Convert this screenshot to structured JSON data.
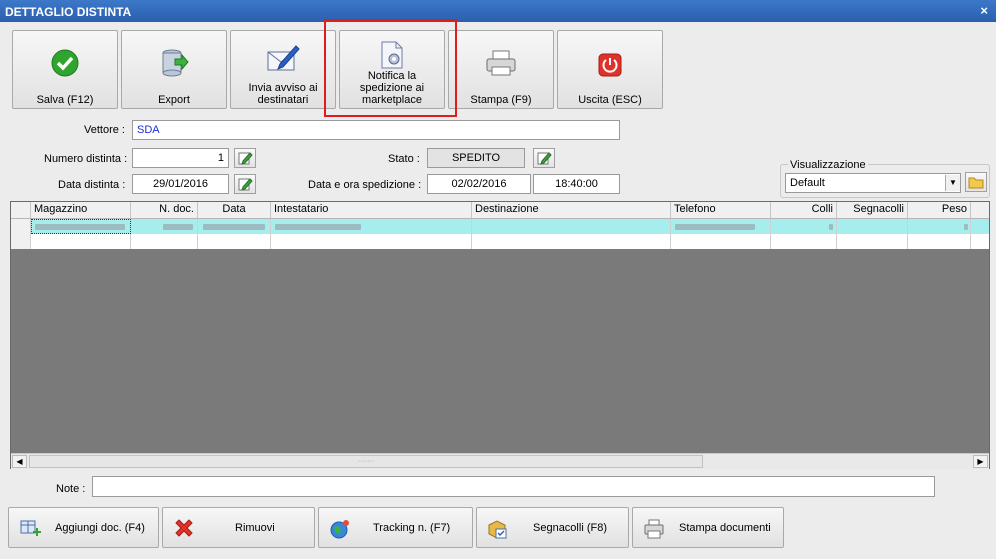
{
  "window": {
    "title": "DETTAGLIO DISTINTA",
    "close": "×"
  },
  "toolbar": {
    "save": "Salva (F12)",
    "export": "Export",
    "notify_recipients": "Invia avviso ai destinatari",
    "notify_marketplace": "Notifica la spedizione ai marketplace",
    "print": "Stampa (F9)",
    "exit": "Uscita (ESC)"
  },
  "form": {
    "carrier_label": "Vettore :",
    "carrier_value": "SDA",
    "number_label": "Numero distinta :",
    "number_value": "1",
    "date_label": "Data distinta :",
    "date_value": "29/01/2016",
    "status_label": "Stato :",
    "status_value": "SPEDITO",
    "ship_label": "Data e ora spedizione :",
    "ship_date": "02/02/2016",
    "ship_time": "18:40:00"
  },
  "view": {
    "label": "Visualizzazione",
    "selected": "Default"
  },
  "grid": {
    "columns": [
      "Magazzino",
      "N. doc.",
      "Data",
      "Intestatario",
      "Destinazione",
      "Telefono",
      "Colli",
      "Segnacolli",
      "Peso"
    ]
  },
  "notes": {
    "label": "Note :",
    "value": ""
  },
  "actions": {
    "add": "Aggiungi doc. (F4)",
    "remove": "Rimuovi",
    "tracking": "Tracking n. (F7)",
    "labels": "Segnacolli (F8)",
    "print_docs": "Stampa documenti"
  },
  "colors": {
    "title_bar": "#2a5fae",
    "highlight": "#e01d1d",
    "selected_row": "#a6eeee",
    "carrier_text": "#1a2fd6"
  }
}
